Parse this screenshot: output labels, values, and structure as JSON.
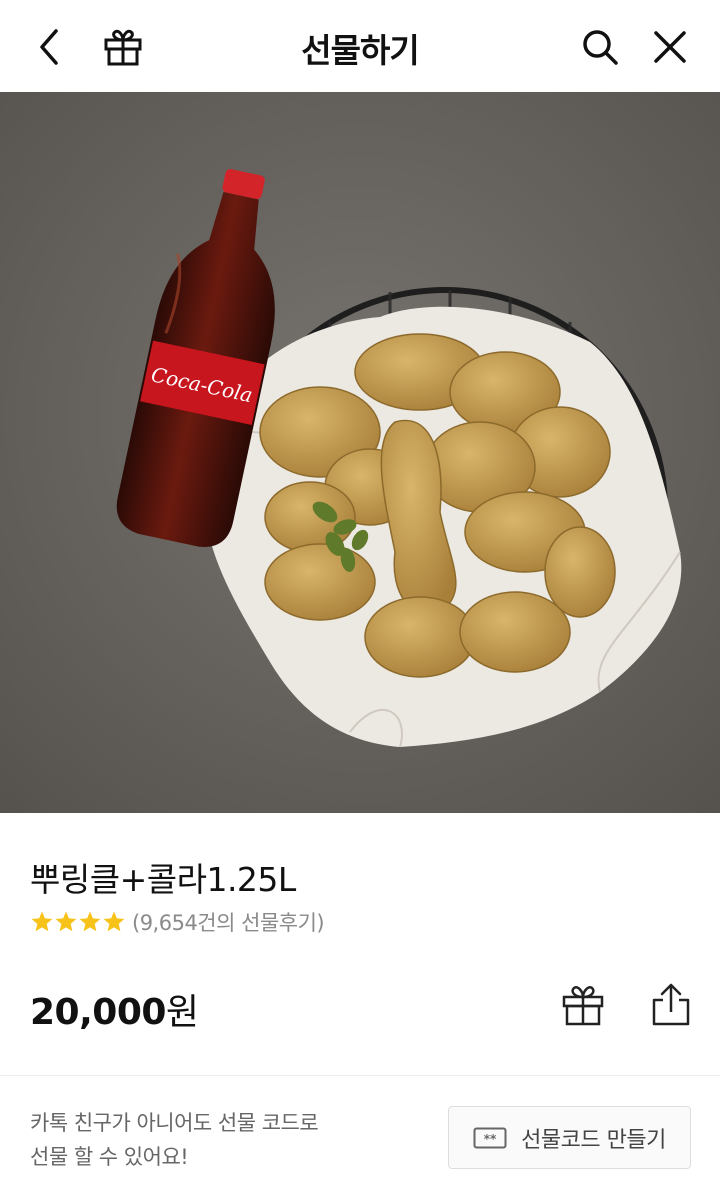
{
  "header": {
    "title": "선물하기",
    "icons": {
      "back": "chevron-left-icon",
      "gift": "gift-icon",
      "search": "search-icon",
      "close": "close-icon"
    }
  },
  "product": {
    "name": "뿌링클+콜라1.25L",
    "rating_stars": 4,
    "review_text": "(9,654건의 선물후기)",
    "price": "20,000",
    "price_unit": "원",
    "image_label": "Coca-Cola"
  },
  "actions": {
    "gift_icon": "gift-icon",
    "share_icon": "share-icon"
  },
  "footer": {
    "line1": "카톡 친구가 아니어도 선물 코드로",
    "line2": "선물 할 수 있어요!",
    "code_button_label": "선물코드 만들기",
    "code_button_icon": "ticket-icon"
  },
  "colors": {
    "star": "#f7c31a",
    "review": "#8a8a8a",
    "footer_text": "#666666"
  }
}
